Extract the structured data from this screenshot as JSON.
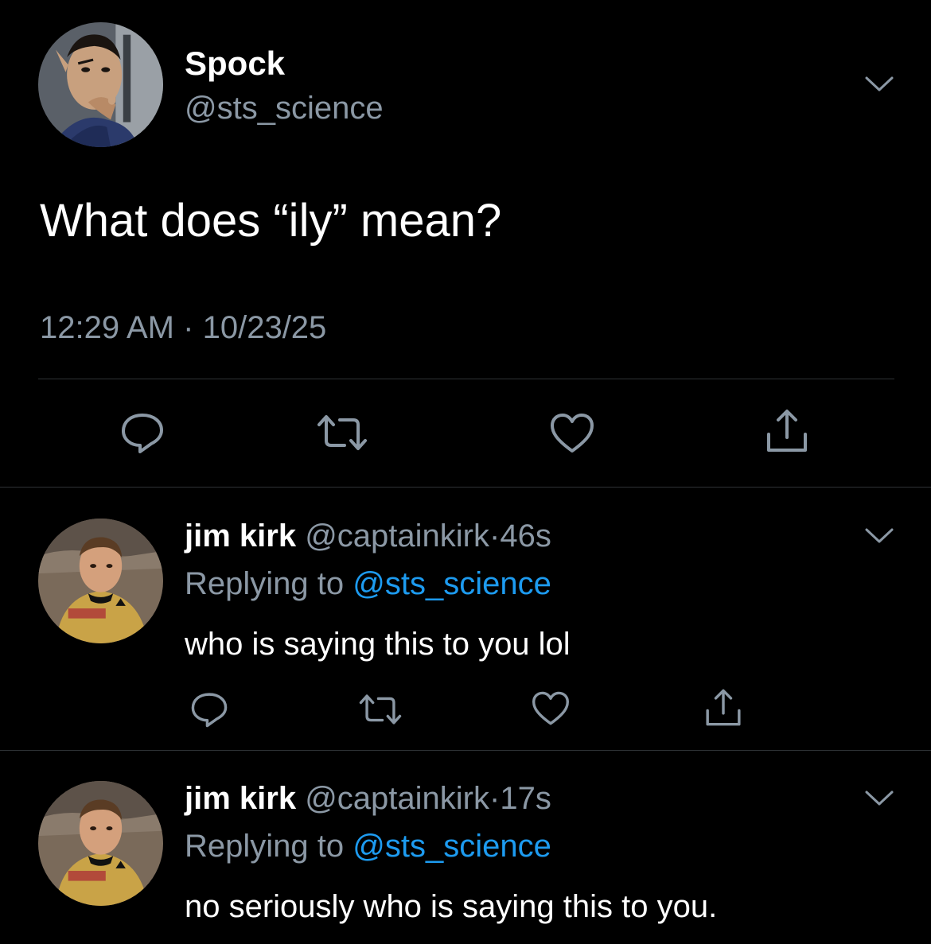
{
  "main_tweet": {
    "author_name": "Spock",
    "author_handle": "@sts_science",
    "text": "What does “ily” mean?",
    "time": "12:29 AM",
    "separator": "·",
    "date": "10/23/25",
    "avatar_icon": "spock-avatar",
    "actions": [
      "reply-icon",
      "retweet-icon",
      "like-icon",
      "share-icon"
    ]
  },
  "replies": [
    {
      "author_name": "jim kirk",
      "author_handle": "@captainkirk",
      "separator": "·",
      "time": "46s",
      "replying_prefix": "Replying to",
      "replying_to": "@sts_science",
      "text": "who is saying this to you lol",
      "avatar_icon": "kirk-avatar"
    },
    {
      "author_name": "jim kirk",
      "author_handle": "@captainkirk",
      "separator": "·",
      "time": "17s",
      "replying_prefix": "Replying to",
      "replying_to": "@sts_science",
      "text": "no seriously who is saying this to you.",
      "avatar_icon": "kirk-avatar"
    }
  ],
  "colors": {
    "background": "#000000",
    "primary_text": "#ffffff",
    "secondary_text": "#8b98a5",
    "link": "#1d9bf0",
    "divider": "#2f3336"
  }
}
